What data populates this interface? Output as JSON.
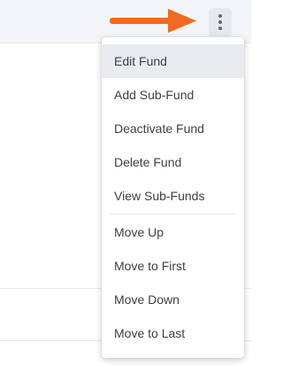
{
  "kebab_icon": "vertical-ellipsis-icon",
  "annotation": {
    "arrow_color": "#f26a21"
  },
  "menu": {
    "group_primary": [
      {
        "label": "Edit Fund",
        "active": true
      },
      {
        "label": "Add Sub-Fund"
      },
      {
        "label": "Deactivate Fund"
      },
      {
        "label": "Delete Fund"
      },
      {
        "label": "View Sub-Funds"
      }
    ],
    "group_order": [
      {
        "label": "Move Up"
      },
      {
        "label": "Move to First"
      },
      {
        "label": "Move Down"
      },
      {
        "label": "Move to Last"
      }
    ]
  }
}
